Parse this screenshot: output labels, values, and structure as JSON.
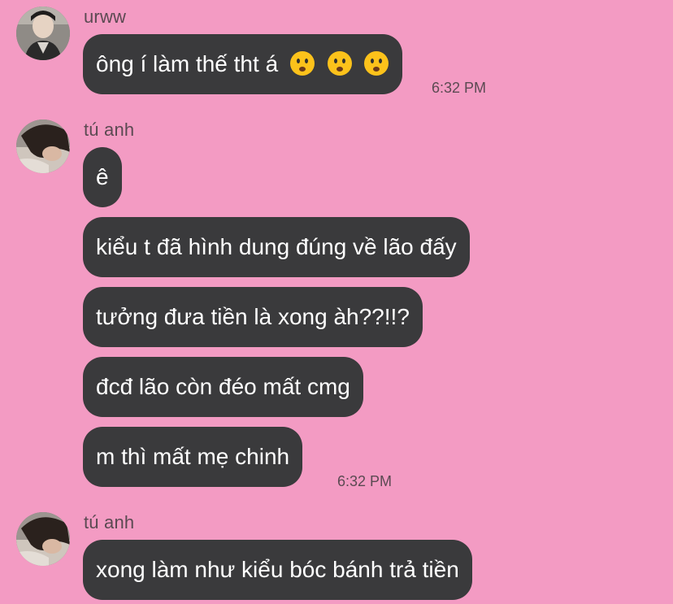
{
  "messages": [
    {
      "sender": "urww",
      "bubbles": [
        {
          "text": "ông í làm thế tht á",
          "emoji": [
            "frowning-face",
            "frowning-face",
            "frowning-face"
          ]
        }
      ],
      "time": "6:32 PM"
    },
    {
      "sender": "tú anh",
      "bubbles": [
        {
          "text": "ê"
        },
        {
          "text": "kiểu t đã hình dung đúng về lão đấy"
        },
        {
          "text": "tưởng đưa tiền là xong àh??!!?"
        },
        {
          "text": "đcđ lão còn đéo mất cmg"
        },
        {
          "text": "m thì mất mẹ chinh"
        }
      ],
      "time": "6:32 PM"
    },
    {
      "sender": "tú anh",
      "bubbles": [
        {
          "text": "xong làm như kiểu bóc bánh trả tiền"
        }
      ]
    }
  ],
  "colors": {
    "background": "#f39bc3",
    "bubble": "#3a3a3c",
    "bubble_text": "#ffffff",
    "meta_text": "#5b4a52"
  }
}
